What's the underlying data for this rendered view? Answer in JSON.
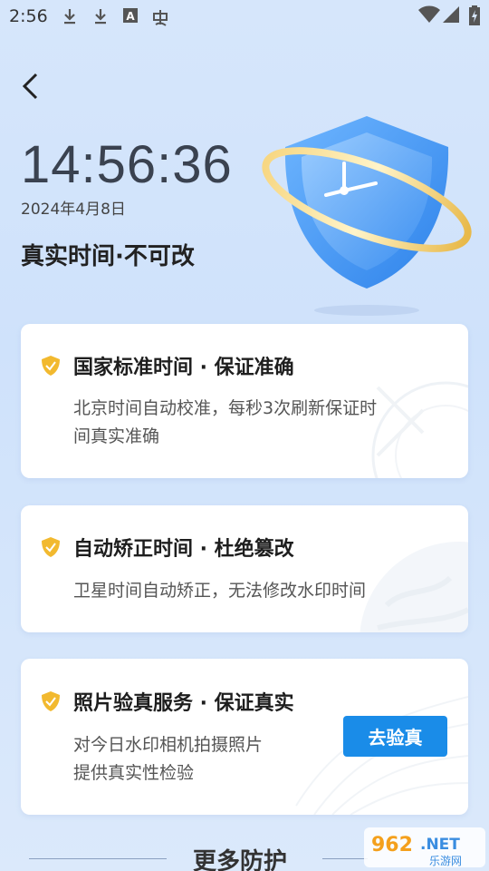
{
  "status_bar": {
    "time": "2:56",
    "icons": [
      "download-icon",
      "download-icon",
      "text-a-icon",
      "bug-icon",
      "wifi-icon",
      "signal-icon",
      "battery-icon"
    ]
  },
  "header": {
    "back_icon": "chevron-left-icon"
  },
  "hero": {
    "time": "14:56:36",
    "date": "2024年4月8日",
    "tagline": "真实时间·不可改",
    "illustration": "shield-clock-icon"
  },
  "cards": [
    {
      "title": "国家标准时间 · 保证准确",
      "desc_line1": "北京时间自动校准，每秒3次刷新保证时",
      "desc_line2": "间真实准确"
    },
    {
      "title": "自动矫正时间 · 杜绝篡改",
      "desc_line1": "卫星时间自动矫正，无法修改水印时间"
    },
    {
      "title": "照片验真服务 · 保证真实",
      "desc_line1": "对今日水印相机拍摄照片",
      "desc_line2": "提供真实性检验",
      "button": "去验真"
    }
  ],
  "more": {
    "title": "更多防护"
  },
  "watermark": {
    "brand": "962.NET",
    "sub": "乐游网"
  },
  "colors": {
    "accent": "#1a8ce8",
    "shield_gold": "#f2b92f",
    "background": "#d6e6fb"
  }
}
